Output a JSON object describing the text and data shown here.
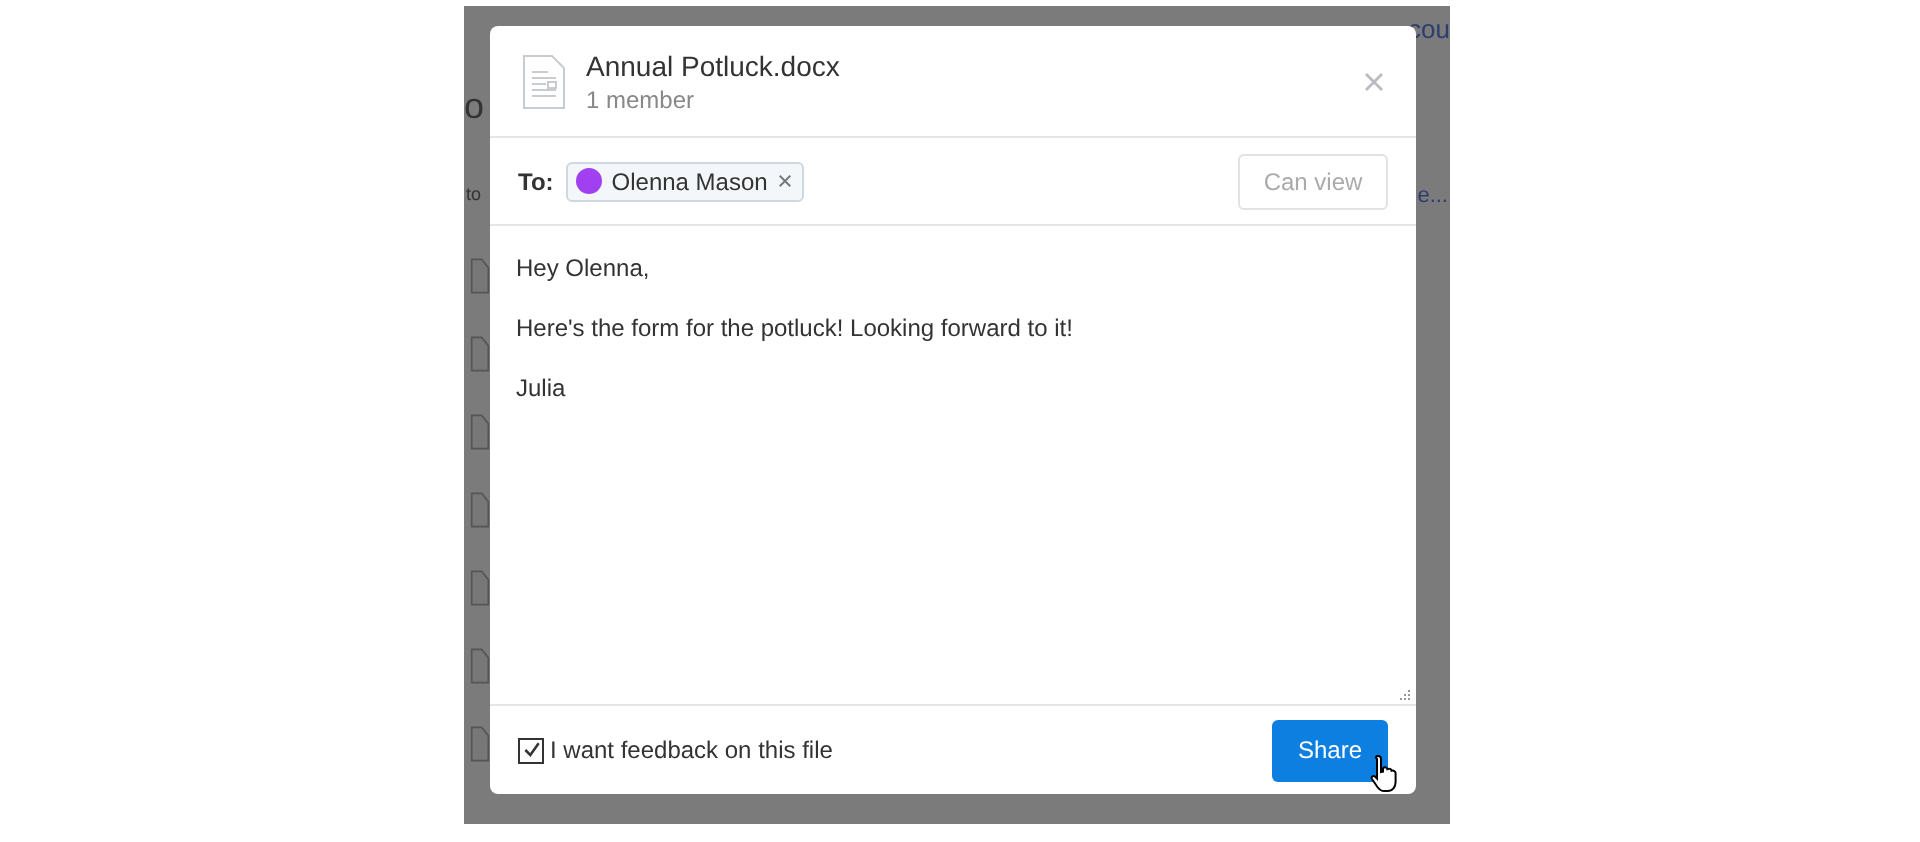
{
  "background": {
    "fragments": [
      "o",
      "to",
      "cou",
      "e..."
    ]
  },
  "dialog": {
    "file_name": "Annual Potluck.docx",
    "members": "1 member",
    "to_label": "To:",
    "recipients": [
      {
        "name": "Olenna Mason",
        "color": "#a040f0"
      }
    ],
    "permission": "Can view",
    "message_lines": [
      "Hey Olenna,",
      "Here's the form for the potluck! Looking forward to it!",
      "Julia"
    ],
    "feedback": {
      "label": "I want feedback on this file",
      "checked": true
    },
    "share_button": "Share"
  }
}
